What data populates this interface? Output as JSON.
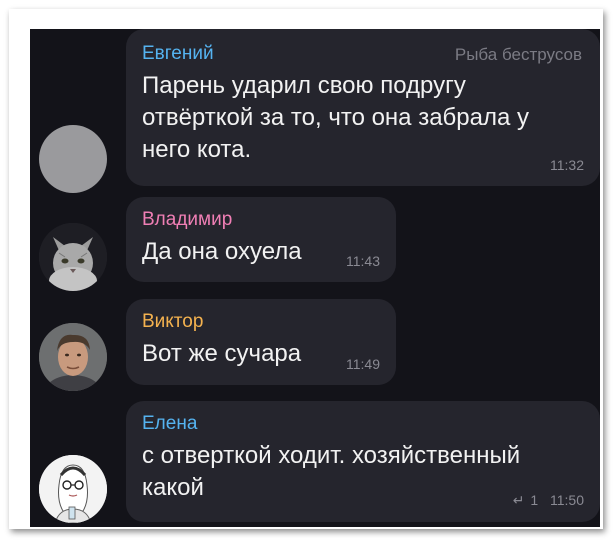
{
  "colors": {
    "background": "#131319",
    "bubble": "#25252d",
    "evgeniy": "#55b3f0",
    "vladimir": "#f07fb5",
    "viktor": "#f4b24f",
    "elena": "#55b3f0"
  },
  "messages": [
    {
      "sender": "Евгений",
      "channel": "Рыба беструсов",
      "text_lines": [
        "Парень ударил свою подругу",
        "отвёрткой за то, что она забрала у",
        "него кота."
      ],
      "time": "11:32",
      "avatar": "gray-placeholder-avatar"
    },
    {
      "sender": "Владимир",
      "text": "Да она охуела",
      "time": "11:43",
      "avatar": "cat-avatar"
    },
    {
      "sender": "Виктор",
      "text": "Вот же сучара",
      "time": "11:49",
      "avatar": "man-photo-avatar"
    },
    {
      "sender": "Елена",
      "text_lines": [
        "с отверткой ходит. хозяйственный",
        "какой"
      ],
      "reply_icon": "reply-icon",
      "reply_count": "1",
      "time": "11:50",
      "avatar": "woman-sketch-avatar"
    }
  ]
}
